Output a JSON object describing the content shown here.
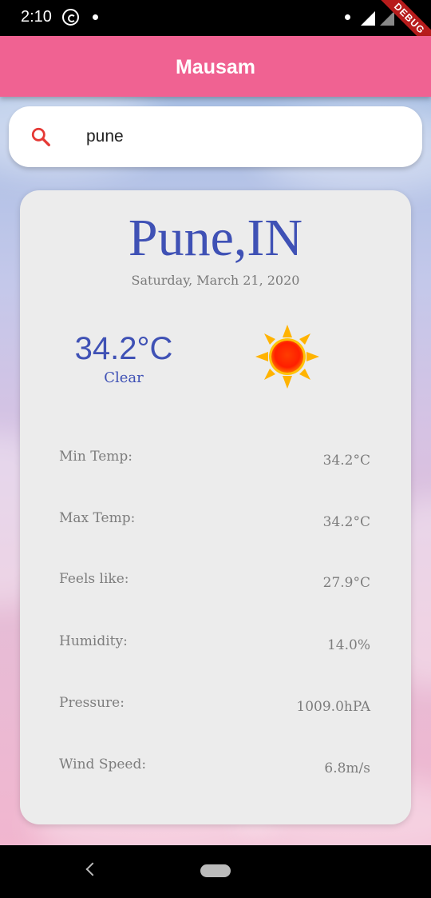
{
  "status_bar": {
    "time": "2:10",
    "debug_label": "DEBUG"
  },
  "app_bar": {
    "title": "Mausam"
  },
  "search": {
    "value": "pune"
  },
  "weather": {
    "city": "Pune,IN",
    "date": "Saturday, March 21, 2020",
    "temperature": "34.2°C",
    "condition": "Clear",
    "icon": "sun-icon",
    "details": [
      {
        "label": "Min Temp:",
        "value": "34.2°C"
      },
      {
        "label": "Max Temp:",
        "value": "34.2°C"
      },
      {
        "label": "Feels like:",
        "value": "27.9°C"
      },
      {
        "label": "Humidity:",
        "value": "14.0%"
      },
      {
        "label": "Pressure:",
        "value": "1009.0hPA"
      },
      {
        "label": "Wind Speed:",
        "value": "6.8m/s"
      }
    ]
  },
  "colors": {
    "app_bar": "#f06292",
    "accent_text": "#3f51b5",
    "card": "#ececec",
    "search_icon": "#e53935"
  }
}
